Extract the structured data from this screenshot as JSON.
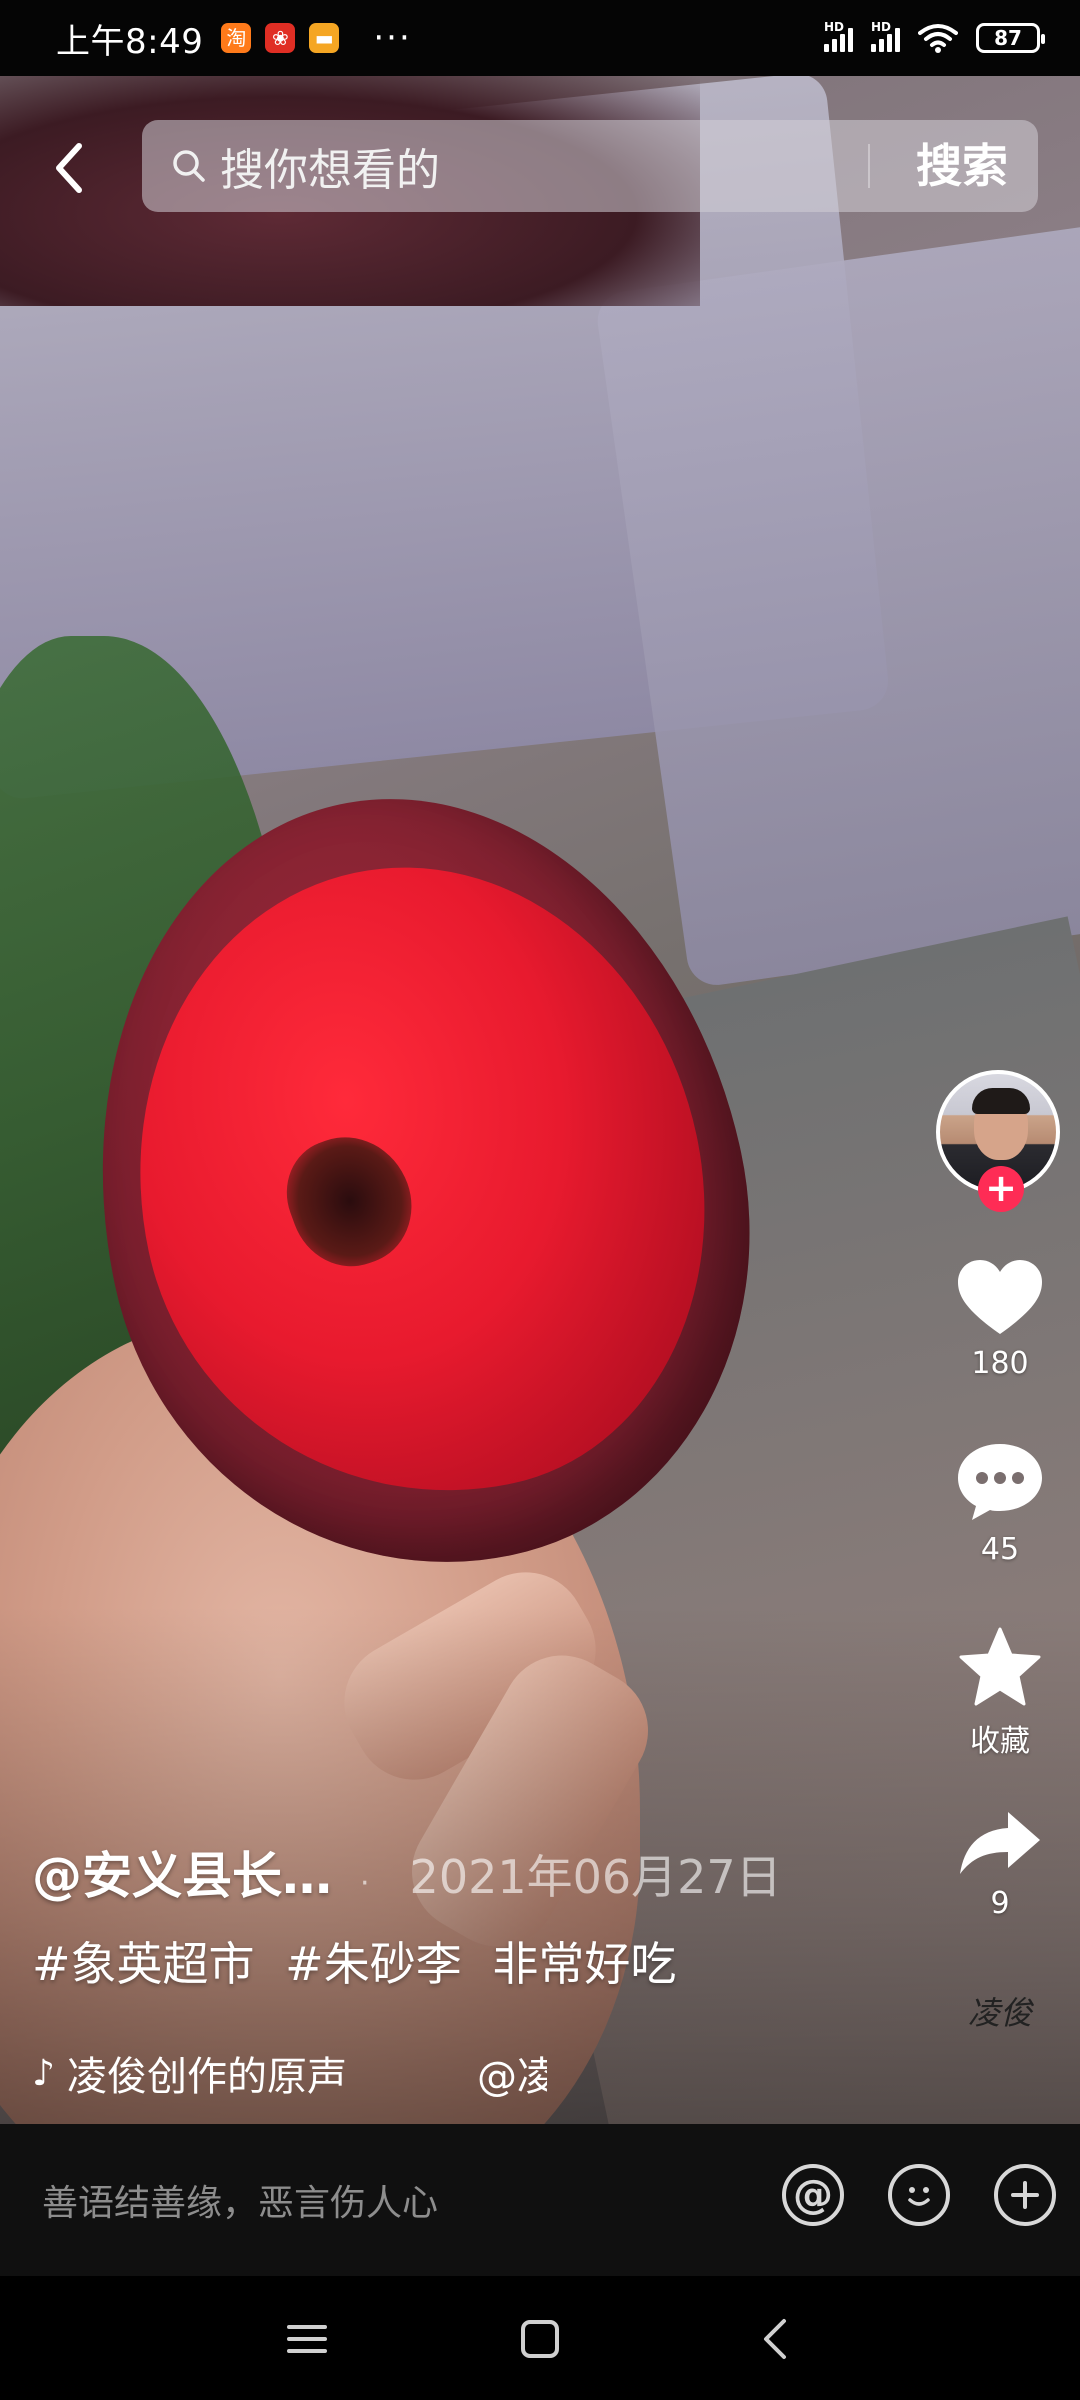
{
  "status_bar": {
    "time": "上午8:49",
    "signal_label_1": "HD",
    "signal_label_2": "HD",
    "battery": "87"
  },
  "search": {
    "placeholder": "搜你想看的",
    "button_label": "搜索"
  },
  "actions": {
    "likes": "180",
    "comments": "45",
    "favorite_label": "收藏",
    "shares": "9"
  },
  "follow_label": "+",
  "caption": {
    "author": "@安义县长…",
    "date": "2021年06月27日",
    "hashtags": [
      "#象英超市",
      "#朱砂李",
      "非常好吃"
    ],
    "music": "凌俊创作的原声",
    "music_mention": "@凌"
  },
  "music_disc_text": "凌俊",
  "comment_bar": {
    "placeholder": "善语结善缘，恶言伤人心"
  },
  "colors": {
    "accent": "#fe2c55",
    "background": "#000000"
  }
}
